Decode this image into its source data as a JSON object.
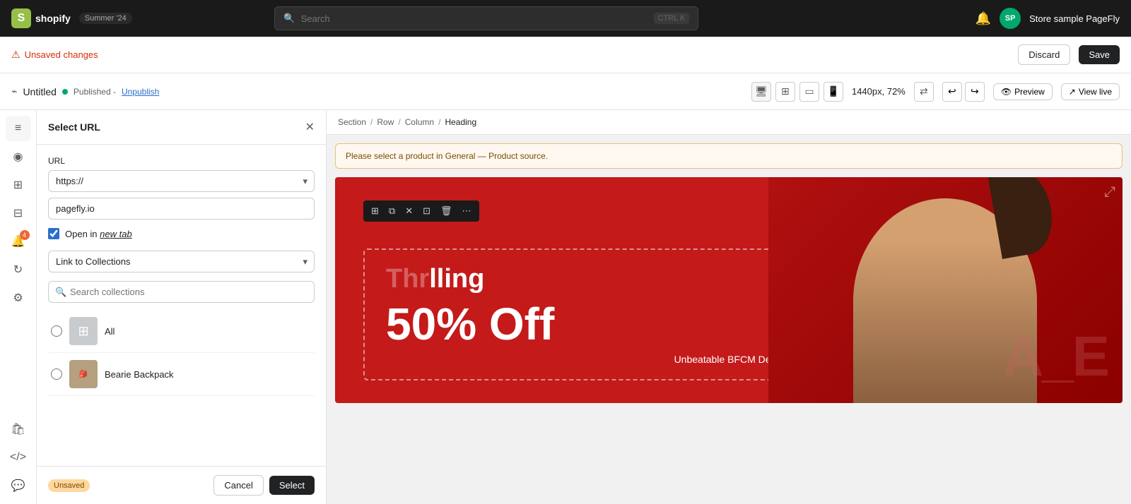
{
  "topnav": {
    "logo_text": "shopify",
    "summer_badge": "Summer '24",
    "search_placeholder": "Search",
    "search_shortcut": "CTRL K",
    "avatar_initials": "SP",
    "store_name": "Store sample PageFly"
  },
  "second_bar": {
    "unsaved_label": "Unsaved changes",
    "discard_label": "Discard",
    "save_label": "Save"
  },
  "third_bar": {
    "page_title": "Untitled",
    "published_label": "Published -",
    "unpublish_label": "Unpublish",
    "zoom_level": "1440px, 72%",
    "preview_label": "Preview",
    "view_live_label": "View live"
  },
  "panel": {
    "title": "Select URL",
    "url_label": "URL",
    "url_scheme": "https://",
    "url_value": "pagefly.io",
    "open_new_tab_label": "Open in",
    "open_new_tab_em": "new tab",
    "link_to_collections_label": "Link to Collections",
    "search_placeholder": "Search collections",
    "collections": [
      {
        "id": "all",
        "name": "All",
        "has_thumb": false
      },
      {
        "id": "bearie",
        "name": "Bearie Backpack",
        "has_thumb": true
      }
    ],
    "unsaved_badge": "Unsaved",
    "cancel_label": "Cancel",
    "select_label": "Select"
  },
  "breadcrumb": {
    "items": [
      "Section",
      "Row",
      "Column",
      "Heading"
    ]
  },
  "canvas": {
    "notification": "Please select a product in General — Product source.",
    "hero_title_partial": "lling",
    "discount_text": "50% Off",
    "deal_text": "Unbeatable BFCM Deals",
    "sale_watermark": "A_E"
  },
  "toolbar": {
    "buttons": [
      "⊞",
      "⧉",
      "✕",
      "⊡",
      "🗑",
      "⋯"
    ]
  }
}
